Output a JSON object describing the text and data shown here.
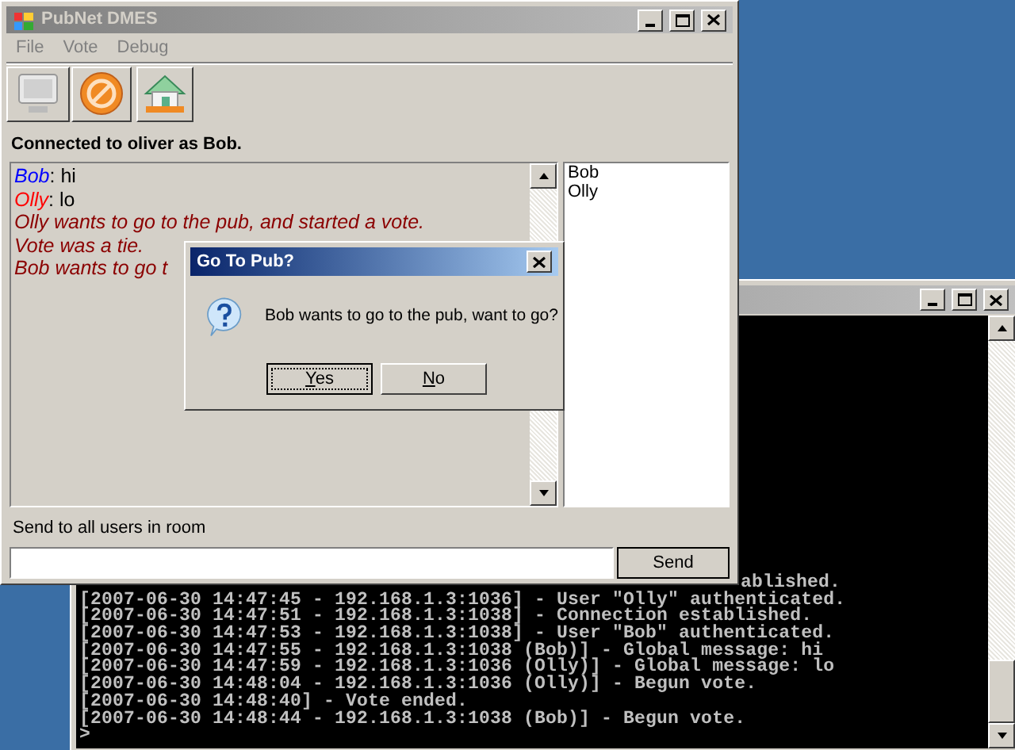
{
  "main_window": {
    "title": "PubNet DMES",
    "active": false,
    "menu": [
      "File",
      "Vote",
      "Debug"
    ],
    "status": "Connected to oliver as Bob.",
    "messages": [
      {
        "kind": "chat",
        "user": "Bob",
        "color": "#0000ff",
        "text": ": hi"
      },
      {
        "kind": "chat",
        "user": "Olly",
        "color": "#ff0000",
        "text": ": lo"
      },
      {
        "kind": "event",
        "text": "Olly wants to go to the pub, and started a vote."
      },
      {
        "kind": "event",
        "text": "Vote was a tie."
      },
      {
        "kind": "event",
        "text": "Bob wants to go t"
      }
    ],
    "users": [
      "Bob",
      "Olly"
    ],
    "send_label": "Send to all users in room",
    "send_button": "Send"
  },
  "console": {
    "active": false,
    "lines": [
      "ablished.",
      "[2007-06-30 14:47:45 - 192.168.1.3:1036] - User \"Olly\" authenticated.",
      "[2007-06-30 14:47:51 - 192.168.1.3:1038] - Connection established.",
      "[2007-06-30 14:47:53 - 192.168.1.3:1038] - User \"Bob\" authenticated.",
      "[2007-06-30 14:47:55 - 192.168.1.3:1038 (Bob)] - Global message: hi",
      "[2007-06-30 14:47:59 - 192.168.1.3:1036 (Olly)] - Global message: lo",
      "[2007-06-30 14:48:04 - 192.168.1.3:1036 (Olly)] - Begun vote.",
      "[2007-06-30 14:48:40] - Vote ended.",
      "[2007-06-30 14:48:44 - 192.168.1.3:1038 (Bob)] - Begun vote.",
      ">"
    ]
  },
  "dialog": {
    "title": "Go To Pub?",
    "active": true,
    "message": "Bob wants to go to the pub, want to go?",
    "buttons": [
      {
        "label": "Yes",
        "selected": true
      },
      {
        "label": "No",
        "selected": false
      }
    ]
  }
}
